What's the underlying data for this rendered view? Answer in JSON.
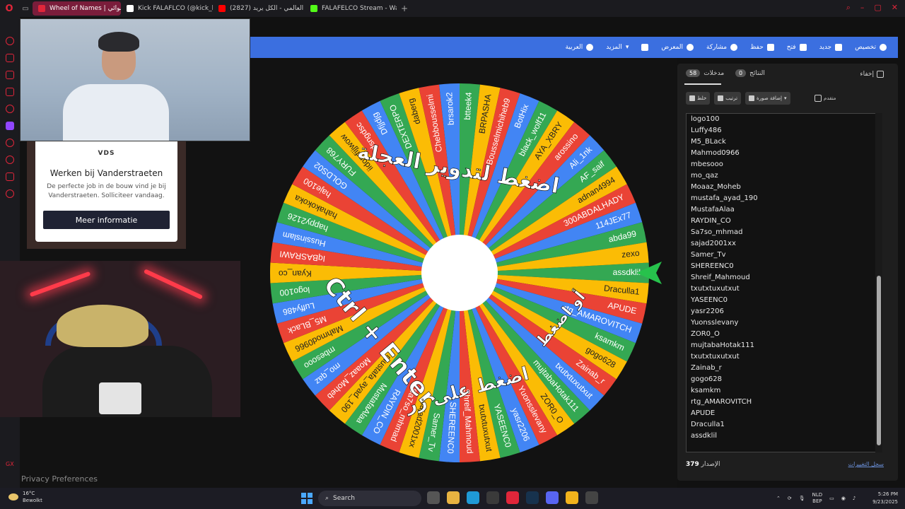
{
  "browser": {
    "tabs": [
      {
        "label": "Wheel of Names | عشوائي",
        "active": true,
        "color": "#e0263a"
      },
      {
        "label": "Kick FALAFLCO (@kick_b",
        "active": false,
        "color": "#ffffff"
      },
      {
        "label": "(2827) العالمي - الكل يريد",
        "active": false,
        "color": "#ff0000"
      },
      {
        "label": "FALAFELCO Stream - Wat",
        "active": false,
        "color": "#53fc18"
      }
    ],
    "new_tab": "+"
  },
  "toolbar": {
    "items": [
      "العربية",
      "المزيد",
      "المعرض",
      "مشاركة",
      "حفظ",
      "فتح",
      "جديد",
      "تخصيص"
    ]
  },
  "ad": {
    "logo": "VDS",
    "title": "Werken bij Vanderstraeten",
    "text": "De perfecte job in de bouw vind je bij Vanderstraeten. Solliciteer vandaag.",
    "button": "Meer informatie"
  },
  "privacy": "Privacy Preferences",
  "gx": "GX",
  "wheel": {
    "overlay_top": "اضغط لتدوير العجلة",
    "overlay_or": "أو اضغط",
    "overlay_ctrl": "Ctrl + Enter",
    "overlay_press": "اضغط على زر",
    "segments": [
      "assdklil",
      "Draculla1",
      "APUDE",
      "rtg_AMAROVITCH",
      "ksamkm",
      "gogo628",
      "Zainab_r",
      "txutxtuxutxut",
      "mujtabaHotak111",
      "ZOR0_O",
      "Yuonsslevany",
      "yasr2206",
      "YASEENC0",
      "txutxtuxutxut",
      "Shreif_Mahmoud",
      "SHEREENC0",
      "Samer_Tv",
      "sajad2001xx",
      "Sa7so_mhmad",
      "RAYDIN_CO",
      "MustafaAlaa",
      "mustafa_ayad_190",
      "Moaaz_Moheb",
      "mo_qaz",
      "mbesooo",
      "Mahmod0966",
      "M5_BLack",
      "Luffy486",
      "logo100",
      "Kyan_co",
      "IqBASRAWI",
      "Hussinslam",
      "happy2126",
      "hahakokoka",
      "haje100",
      "GOLDS02",
      "FURY768",
      "iidoryfijjwow",
      "dsngdsc",
      "Dfjjdjg",
      "DEXTERPO",
      "daberg",
      "Chebbousselmi",
      "brsarok2",
      "btteek4",
      "BRPASHA",
      "Bousselmichiheb9",
      "BotHix",
      "black_wolf11",
      "AYA_XBRY",
      "arossino",
      "Ali_1nk",
      "AF_saif",
      "adnan4994",
      "300ABDALHADY",
      "114JEx77",
      "abda99",
      "zexo"
    ],
    "colors": [
      "#34a853",
      "#fbbc05",
      "#ea4335",
      "#4285f4"
    ]
  },
  "panel": {
    "tab_entries": "مدخلات",
    "entries_count": "58",
    "tab_results": "النتائج",
    "results_count": "0",
    "hide": "إخفاء",
    "shuffle": "خلط",
    "sort": "ترتيب",
    "add_image": "إضافة صورة",
    "advanced": "متقدم",
    "entries": [
      "logo100",
      "Luffy486",
      "M5_BLack",
      "Mahmod0966",
      "mbesooo",
      "mo_qaz",
      "Moaaz_Moheb",
      "mustafa_ayad_190",
      "MustafaAlaa",
      "RAYDIN_CO",
      "Sa7so_mhmad",
      "sajad2001xx",
      "Samer_Tv",
      "SHEREENC0",
      "Shreif_Mahmoud",
      "txutxtuxutxut",
      "YASEENC0",
      "yasr2206",
      "Yuonsslevany",
      "ZOR0_O",
      "mujtabaHotak111",
      "txutxtuxutxut",
      "Zainab_r",
      "gogo628",
      "ksamkm",
      "rtg_AMAROVITCH",
      "APUDE",
      "Draculla1",
      "assdklil"
    ],
    "version_label": "الإصدار",
    "version": "379",
    "changelog": "سجل التغييرات"
  },
  "taskbar": {
    "temp": "16°C",
    "weather": "Bewolkt",
    "search": "Search",
    "lang1": "NLD",
    "lang2": "BEP",
    "time": "5:26 PM",
    "date": "9/23/2025"
  }
}
